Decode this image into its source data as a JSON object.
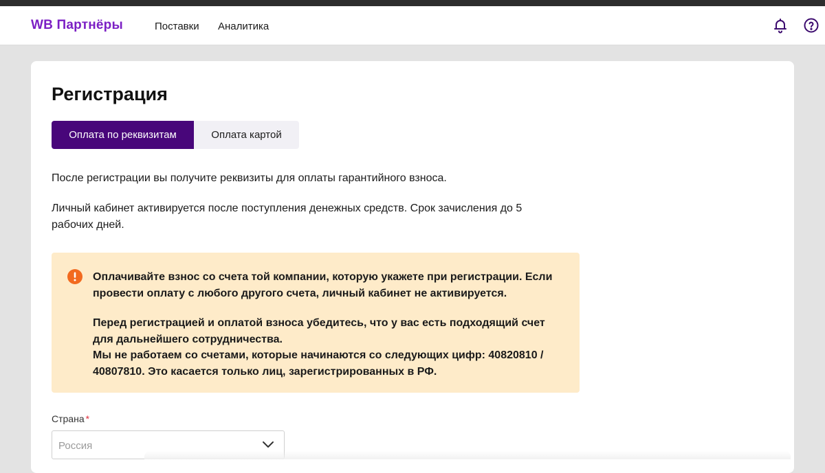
{
  "header": {
    "logo": "WB Партнёры",
    "nav": [
      "Поставки",
      "Аналитика"
    ],
    "icons": [
      "bell-icon",
      "help-icon"
    ],
    "brand_color": "#7b1fc4"
  },
  "page": {
    "title": "Регистрация",
    "tabs": [
      {
        "label": "Оплата по реквизитам",
        "active": true
      },
      {
        "label": "Оплата картой",
        "active": false
      }
    ],
    "tab_active_color": "#48067a",
    "paragraph1": "После регистрации вы получите реквизиты для оплаты гарантийного взноса.",
    "paragraph2": "Личный кабинет активируется после поступления денежных средств. Срок зачисления до 5 рабочих дней."
  },
  "warning": {
    "icon": "exclamation-circle-icon",
    "background": "#feebc9",
    "icon_color": "#f26a1f",
    "text1": "Оплачивайте взнос со счета той компании, которую укажете при регистрации. Если провести оплату с любого другого счета, личный кабинет не активируется.",
    "text2_line1": "Перед регистрацией и оплатой взноса убедитесь, что у вас есть подходящий счет для дальнейшего сотрудничества.",
    "text2_line2": "Мы не работаем со счетами, которые начинаются со следующих цифр: 40820810 / 40807810. Это касается только лиц, зарегистрированных в РФ."
  },
  "form": {
    "country_label": "Страна",
    "required_mark": "*",
    "country_value": "Россия"
  }
}
